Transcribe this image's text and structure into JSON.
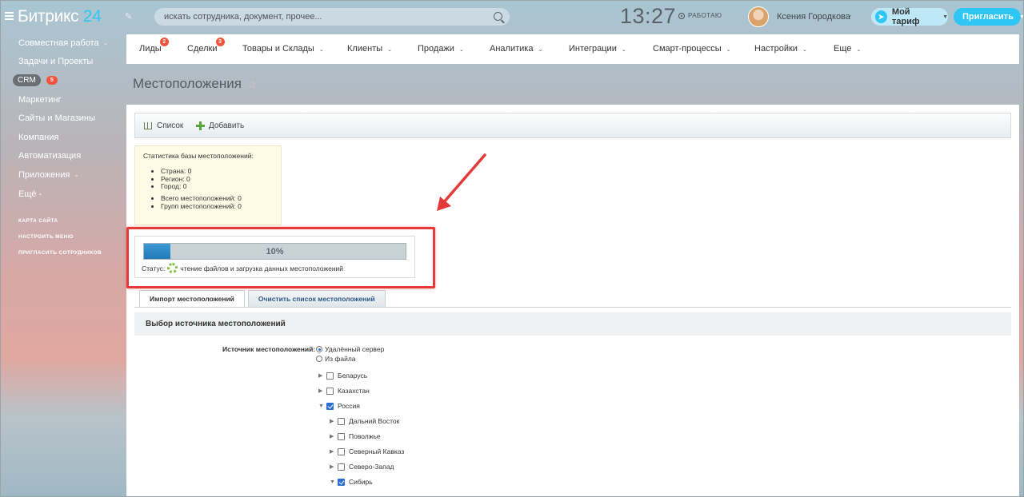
{
  "header": {
    "logo_main": "Битрикс",
    "logo_num": "24",
    "search_placeholder": "искать сотрудника, документ, прочее...",
    "clock": "13:27",
    "work_status": "РАБОТАЮ",
    "user_name": "Ксения Городкова",
    "tariff_label": "Мой тариф",
    "invite_label": "Пригласить"
  },
  "sidebar": {
    "items": [
      {
        "label": "Совместная работа",
        "chevron": true
      },
      {
        "label": "Задачи и Проекты"
      },
      {
        "label": "CRM",
        "badge": "5"
      },
      {
        "label": "Маркетинг"
      },
      {
        "label": "Сайты и Магазины"
      },
      {
        "label": "Компания"
      },
      {
        "label": "Автоматизация"
      },
      {
        "label": "Приложения",
        "chevron": true
      },
      {
        "label": "Ещё -"
      }
    ],
    "links": [
      "КАРТА САЙТА",
      "НАСТРОИТЬ МЕНЮ",
      "ПРИГЛАСИТЬ СОТРУДНИКОВ"
    ]
  },
  "topnav": {
    "items": [
      {
        "label": "Лиды",
        "badge": "2"
      },
      {
        "label": "Сделки",
        "badge": "3"
      },
      {
        "label": "Товары и Склады",
        "chevron": true
      },
      {
        "label": "Клиенты",
        "chevron": true
      },
      {
        "label": "Продажи",
        "chevron": true
      },
      {
        "label": "Аналитика",
        "chevron": true
      },
      {
        "label": "Интеграции",
        "chevron": true
      },
      {
        "label": "Смарт-процессы",
        "chevron": true
      },
      {
        "label": "Настройки",
        "chevron": true
      },
      {
        "label": "Еще",
        "chevron": true
      }
    ]
  },
  "page": {
    "title": "Местоположения"
  },
  "toolbar": {
    "list_label": "Список",
    "add_label": "Добавить"
  },
  "stats": {
    "title": "Статистика базы местоположений:",
    "group1": [
      "Страна: 0",
      "Регион: 0",
      "Город: 0"
    ],
    "group2": [
      "Всего местоположений: 0",
      "Групп местоположений: 0"
    ]
  },
  "progress": {
    "value": 0.1,
    "text": "10%",
    "status_label": "Статус:",
    "status_text": "чтение файлов и загрузка данных местоположений"
  },
  "tabs": [
    "Импорт местоположений",
    "Очистить список местоположений"
  ],
  "section": {
    "heading": "Выбор источника местоположений",
    "source_label": "Источник местоположений:",
    "radio_remote": "Удалённый сервер",
    "radio_file": "Из файла"
  },
  "tree": [
    {
      "label": "Беларусь",
      "checked": false,
      "level": 0,
      "expanded": false
    },
    {
      "label": "Казахстан",
      "checked": false,
      "level": 0,
      "expanded": false
    },
    {
      "label": "Россия",
      "checked": true,
      "level": 0,
      "expanded": true
    },
    {
      "label": "Дальний Восток",
      "checked": false,
      "level": 1,
      "expanded": false
    },
    {
      "label": "Поволжье",
      "checked": false,
      "level": 1,
      "expanded": false
    },
    {
      "label": "Северный Кавказ",
      "checked": false,
      "level": 1,
      "expanded": false
    },
    {
      "label": "Северо-Запад",
      "checked": false,
      "level": 1,
      "expanded": false
    },
    {
      "label": "Сибирь",
      "checked": true,
      "level": 1,
      "expanded": true
    }
  ],
  "colors": {
    "accent": "#2fc6f6",
    "badge": "#f4543c",
    "highlight": "#e53a3a",
    "progress": "#2379b8"
  }
}
